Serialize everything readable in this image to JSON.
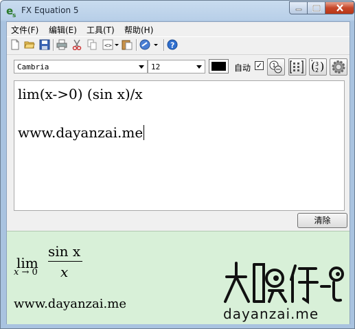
{
  "window": {
    "title": "FX Equation 5",
    "colors": {
      "close": "#c6472a",
      "preview_bg": "#d8f0d8"
    }
  },
  "menu": {
    "items": [
      "文件(F)",
      "编辑(E)",
      "工具(T)",
      "帮助(H)"
    ]
  },
  "toolbar": {
    "icons": [
      "new-icon",
      "open-icon",
      "save-icon",
      "print-icon",
      "cut-icon",
      "copy-icon",
      "code-icon",
      "paste-icon",
      "link-icon",
      "help-icon"
    ]
  },
  "format": {
    "font": "Cambria",
    "size": "12",
    "color": "#000000",
    "auto_label": "自动",
    "auto_checked": true,
    "auto_check_mark": "✓"
  },
  "editor": {
    "line1": "lim(x->0) (sin x)/x",
    "line2": "www.dayanzai.me"
  },
  "clear_label": "清除",
  "preview": {
    "lim": "lim",
    "lim_var": "x",
    "lim_arrow": "→",
    "lim_target": "0",
    "numerator": "sin x",
    "denominator": "x",
    "url": "www.dayanzai.me",
    "watermark_text": "dayanzai.me"
  }
}
